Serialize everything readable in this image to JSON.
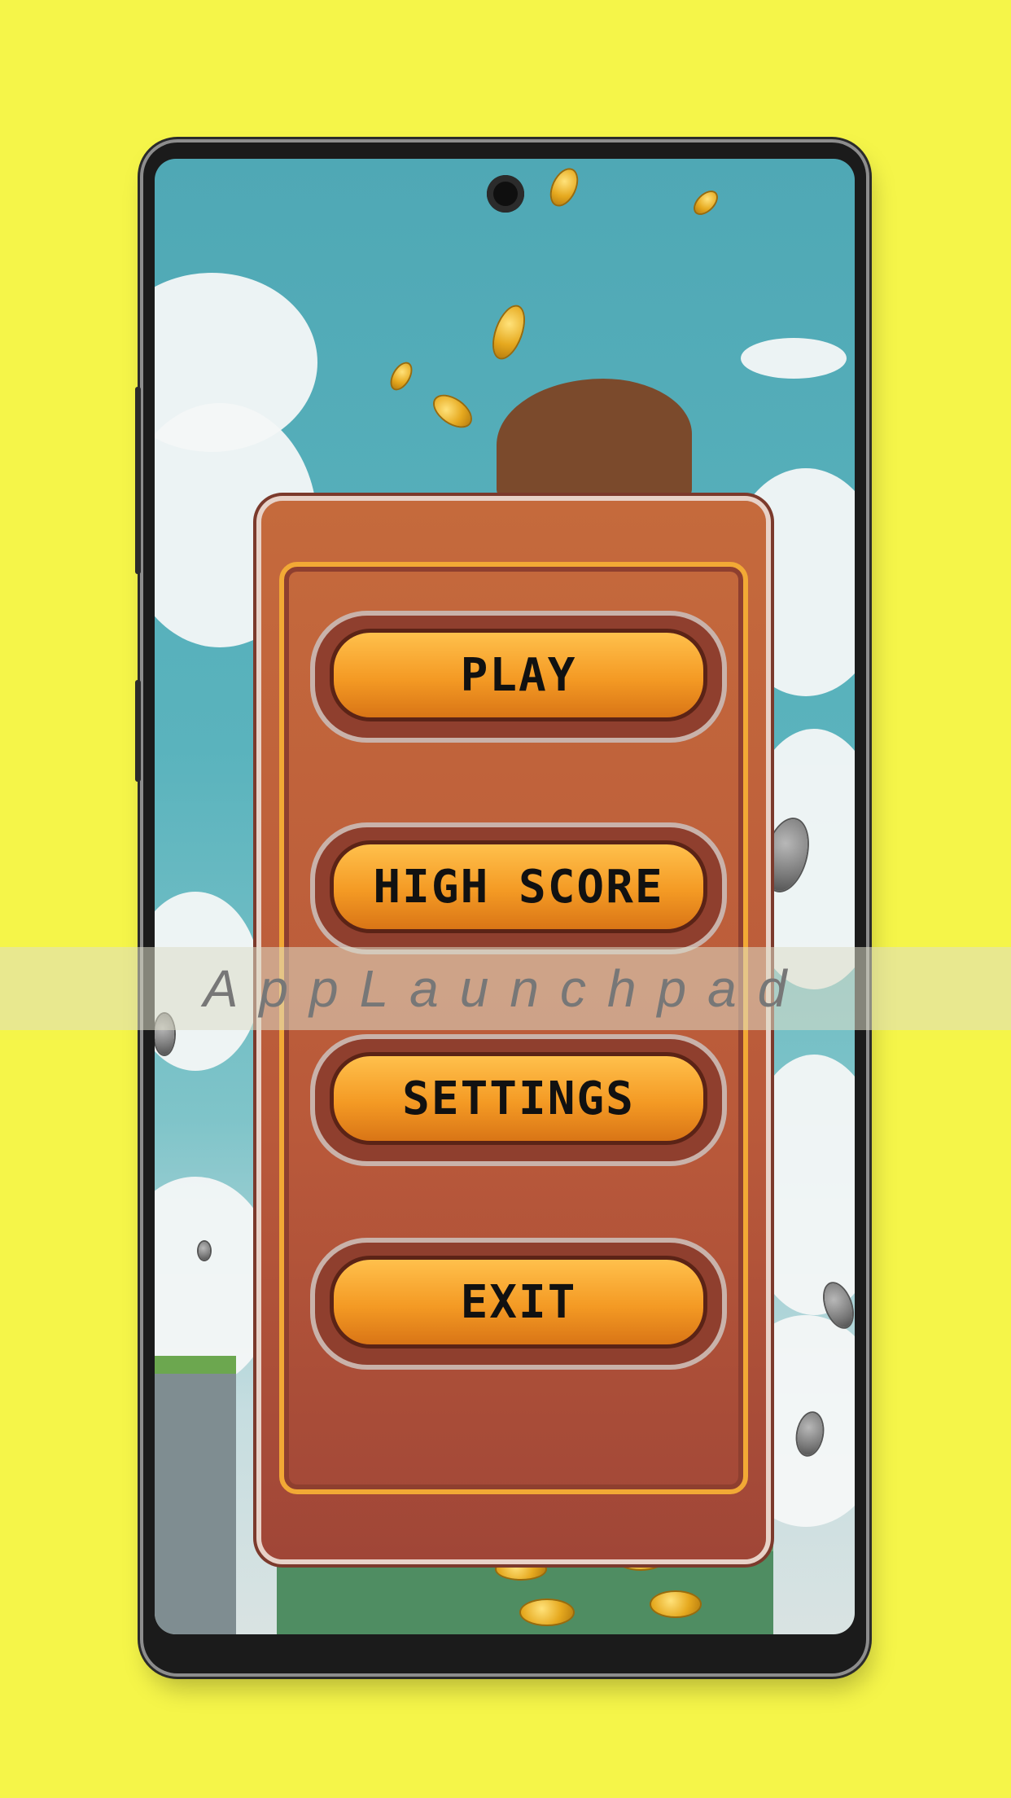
{
  "menu": {
    "buttons": [
      {
        "label": "PLAY"
      },
      {
        "label": "HIGH SCORE"
      },
      {
        "label": "SETTINGS"
      },
      {
        "label": "EXIT"
      }
    ]
  },
  "watermark": {
    "text": "AppLaunchpad"
  },
  "colors": {
    "background": "#f5f549",
    "board": "#b9593a",
    "button_face": "#f49a24",
    "button_text": "#111111"
  }
}
